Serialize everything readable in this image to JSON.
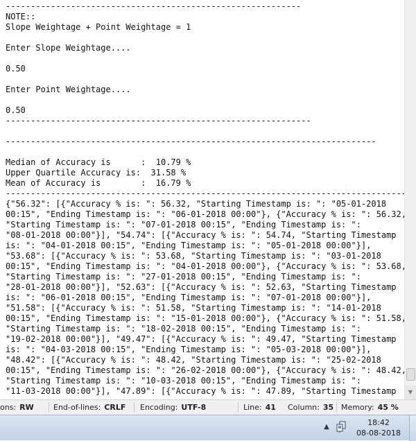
{
  "editor": {
    "lines": [
      "-----------------------------------------------------------",
      "NOTE::",
      "Slope Weightage + Point Weightage = 1",
      "",
      "Enter Slope Weightage....",
      "",
      "0.50",
      "",
      "Enter Point Weightage....",
      "",
      "0.50",
      "-------------------------------------------------------------",
      "",
      "--------------------------------------------------------------------------",
      "",
      "Median of Accuracy is      :  10.79 %",
      "Upper Quartile Accuracy is:  31.58 %",
      "Mean of Accuracy is        :  16.79 %",
      "-----------------------------------------------------------------------------------------------",
      "{\"56.32\": [{\"Accuracy % is: \": 56.32, \"Starting Timestamp is: \": \"05-01-2018",
      "00:15\", \"Ending Timestamp is: \": \"06-01-2018 00:00\"}, {\"Accuracy % is: \": 56.32,",
      "\"Starting Timestamp is: \": \"07-01-2018 00:15\", \"Ending Timestamp is: \":",
      "\"08-01-2018 00:00\"}], \"54.74\": [{\"Accuracy % is: \": 54.74, \"Starting Timestamp",
      "is: \": \"04-01-2018 00:15\", \"Ending Timestamp is: \": \"05-01-2018 00:00\"}],",
      "\"53.68\": [{\"Accuracy % is: \": 53.68, \"Starting Timestamp is: \": \"03-01-2018",
      "00:15\", \"Ending Timestamp is: \": \"04-01-2018 00:00\"}, {\"Accuracy % is: \": 53.68,",
      "\"Starting Timestamp is: \": \"27-01-2018 00:15\", \"Ending Timestamp is: \":",
      "\"28-01-2018 00:00\"}], \"52.63\": [{\"Accuracy % is: \": 52.63, \"Starting Timestamp",
      "is: \": \"06-01-2018 00:15\", \"Ending Timestamp is: \": \"07-01-2018 00:00\"}],",
      "\"51.58\": [{\"Accuracy % is: \": 51.58, \"Starting Timestamp is: \": \"14-01-2018",
      "00:15\", \"Ending Timestamp is: \": \"15-01-2018 00:00\"}, {\"Accuracy % is: \": 51.58,",
      "\"Starting Timestamp is: \": \"18-02-2018 00:15\", \"Ending Timestamp is: \":",
      "\"19-02-2018 00:00\"}], \"49.47\": [{\"Accuracy % is: \": 49.47, \"Starting Timestamp",
      "is: \": \"04-03-2018 00:15\", \"Ending Timestamp is: \": \"05-03-2018 00:00\"}],",
      "\"48.42\": [{\"Accuracy % is: \": 48.42, \"Starting Timestamp is: \": \"25-02-2018",
      "00:15\", \"Ending Timestamp is: \": \"26-02-2018 00:00\"}, {\"Accuracy % is: \": 48.42,",
      "\"Starting Timestamp is: \": \"10-03-2018 00:15\", \"Ending Timestamp is: \":",
      "\"11-03-2018 00:00\"}], \"47.89\": [{\"Accuracy % is: \": 47.89, \"Starting Timestamp"
    ]
  },
  "statusbar": {
    "options_label": "ons:",
    "options_value": "RW",
    "eol_label": "End-of-lines:",
    "eol_value": "CRLF",
    "encoding_label": "Encoding:",
    "encoding_value": "UTF-8",
    "line_label": "Line:",
    "line_value": "41",
    "column_label": "Column:",
    "column_value": "35",
    "memory_label": "Memory:",
    "memory_value": "45 %"
  },
  "taskbar": {
    "time": "18:42",
    "date": "08-08-2018",
    "icons": [
      "tray-chevron-icon",
      "network-icon"
    ]
  }
}
